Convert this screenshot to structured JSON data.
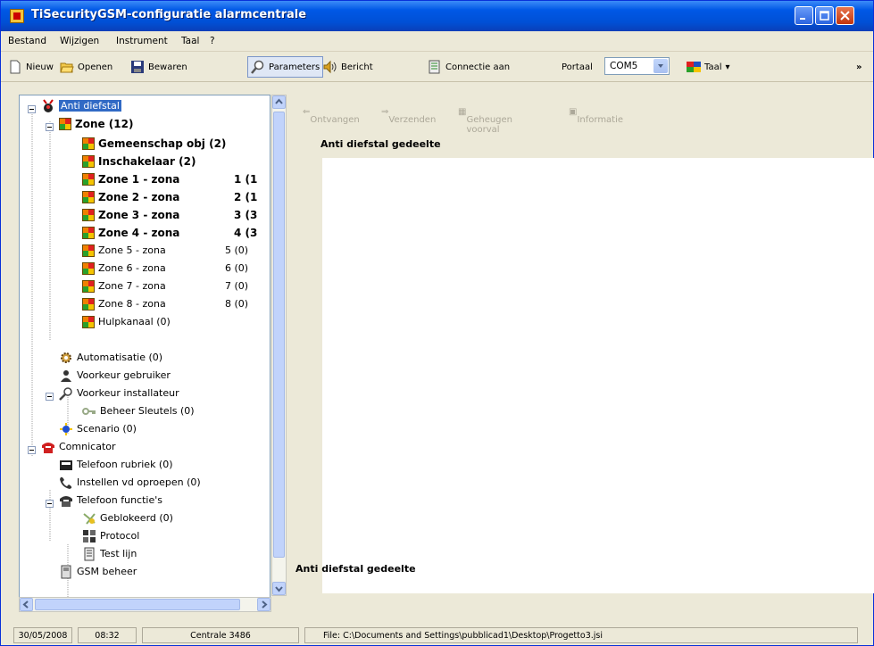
{
  "window": {
    "title": "TiSecurityGSM-configuratie  alarmcentrale"
  },
  "menu": [
    "Bestand",
    "Wijzigen",
    "Instrument",
    "Taal",
    "?"
  ],
  "toolbar": {
    "new": "Nieuw",
    "open": "Openen",
    "save": "Bewaren",
    "parameters": "Parameters",
    "message": "Bericht",
    "connect": "Connectie aan",
    "port_label": "Portaal",
    "port_value": "COM5",
    "language": "Taal",
    "more": "»"
  },
  "tree": {
    "root": "Anti diefstal",
    "zone": "Zone (12)",
    "items": [
      {
        "label": "Gemeenschap obj (2)",
        "count": "",
        "bold": true
      },
      {
        "label": "Inschakelaar (2)",
        "count": "",
        "bold": true
      },
      {
        "label": "Zone 1 - zona",
        "count": "1 (1",
        "bold": true
      },
      {
        "label": "Zone 2 - zona",
        "count": "2 (1",
        "bold": true
      },
      {
        "label": "Zone 3 - zona",
        "count": "3 (3",
        "bold": true
      },
      {
        "label": "Zone 4 - zona",
        "count": "4 (3",
        "bold": true
      },
      {
        "label": "Zone 5 - zona",
        "count": "5 (0)",
        "bold": false
      },
      {
        "label": "Zone 6 - zona",
        "count": "6 (0)",
        "bold": false
      },
      {
        "label": "Zone 7 - zona",
        "count": "7 (0)",
        "bold": false
      },
      {
        "label": "Zone 8 - zona",
        "count": "8 (0)",
        "bold": false
      },
      {
        "label": "Hulpkanaal (0)",
        "count": "",
        "bold": false
      }
    ],
    "automation": "Automatisatie (0)",
    "user_pref": "Voorkeur gebruiker",
    "installer_pref": "Voorkeur installateur",
    "keys": "Beheer Sleutels (0)",
    "scenario": "Scenario (0)",
    "communicator": "Comnicator",
    "phonebook": "Telefoon rubriek (0)",
    "call_settings": "Instellen vd oproepen (0)",
    "phone_functions": "Telefoon functie's",
    "blocked": "Geblokeerd (0)",
    "protocol": "Protocol",
    "testline": "Test lijn",
    "gsm": "GSM beheer"
  },
  "right": {
    "receive": "Ontvangen",
    "send": "Verzenden",
    "memory": "Geheugen voorval",
    "info": "Informatie",
    "header": "Anti diefstal gedeelte",
    "footer": "Anti diefstal gedeelte"
  },
  "status": {
    "date": "30/05/2008",
    "time": "08:32",
    "centrale": "Centrale 3486",
    "file": "File: C:\\Documents and Settings\\pubblicad1\\Desktop\\Progetto3.jsi"
  }
}
